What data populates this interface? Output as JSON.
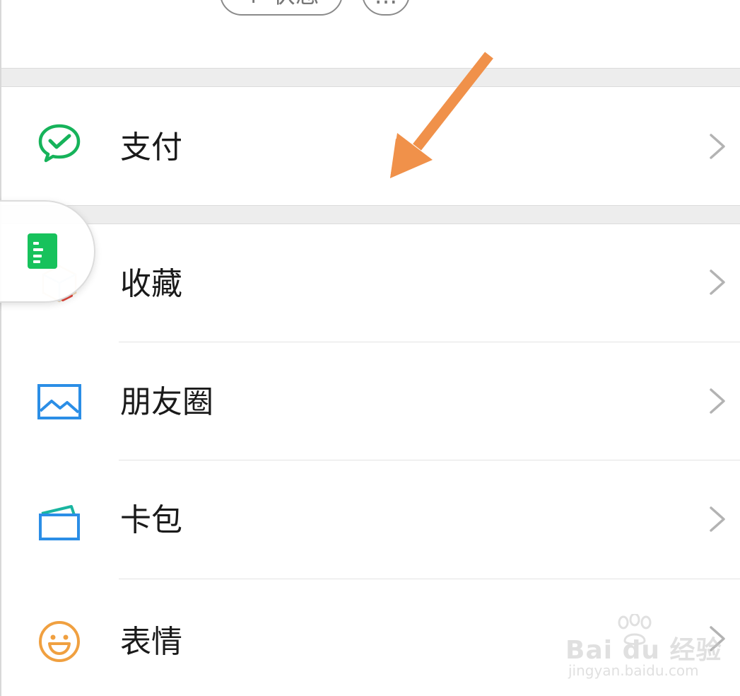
{
  "top": {
    "status_button_label": "+ 状态",
    "more_button_label": "..."
  },
  "menu": {
    "pay": {
      "label": "支付",
      "icon": "wechat-pay-icon",
      "color": "#16b35a"
    },
    "favorites": {
      "label": "收藏",
      "icon": "favorites-cube-icon"
    },
    "moments": {
      "label": "朋友圈",
      "icon": "moments-photo-icon",
      "color": "#2b8ee6"
    },
    "cards": {
      "label": "卡包",
      "icon": "card-wallet-icon",
      "color": "#2b8ee6"
    },
    "stickers": {
      "label": "表情",
      "icon": "smiley-face-icon",
      "color": "#f0a040"
    }
  },
  "floating_window": {
    "icon": "document-icon",
    "color": "#17c25c"
  },
  "annotation": {
    "arrow_color": "#f0914a"
  },
  "watermark": {
    "main": "Bai du 经验",
    "sub": "jingyan.baidu.com"
  }
}
